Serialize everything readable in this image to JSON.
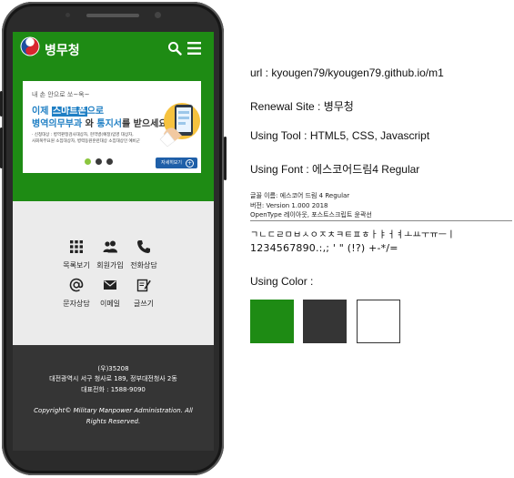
{
  "phone": {
    "header": {
      "logo_text": "병무청",
      "search_icon": "search-icon",
      "menu_icon": "hamburger-menu-icon"
    },
    "banner": {
      "small_text": "내 손 안으로 쏘~옥~",
      "line1_a": "이제 ",
      "line1_b": "스마트폰",
      "line1_c": "으로",
      "line2_a": "병역의무부과",
      "line2_b": " 와 ",
      "line2_c": "통지서",
      "line2_d": "를 받으세요!",
      "info_1": "· 신청대상 : 병역판정검사대상자, 현역병(예정)입영 대상자,",
      "info_2": "  사회복무요원 소집대상자, 병력동원훈련대상 소집대상인 예비군",
      "more_label": "자세히보기",
      "dots_active_index": 0,
      "dot_count": 3
    },
    "quick_menu": [
      {
        "label": "목록보기",
        "icon": "grid-icon"
      },
      {
        "label": "회원가입",
        "icon": "users-icon"
      },
      {
        "label": "전화상담",
        "icon": "phone-icon"
      },
      {
        "label": "문자상담",
        "icon": "at-sign-icon"
      },
      {
        "label": "이메일",
        "icon": "envelope-icon"
      },
      {
        "label": "글쓰기",
        "icon": "write-icon"
      }
    ],
    "footer": {
      "postcode": "(우)35208",
      "address": "대전광역시 서구 청사로 189, 정부대전청사 2동",
      "phone": "대표전화 : 1588-9090",
      "copyright_1": "Copyright© Military Manpower Administration. All",
      "copyright_2": "Rights Reserved."
    }
  },
  "info": {
    "url": "url : kyougen79/kyougen79.github.io/m1",
    "renewal_site": "Renewal Site : 병무청",
    "using_tool": "Using Tool : HTML5, CSS, Javascript",
    "using_font": "Using Font : 에스코어드림4 Regular",
    "font_meta": {
      "name": "글꼴 이름: 에스코어 드림 4 Regular",
      "version": "버전: Version 1.000 2018",
      "type": "OpenType 레이아웃, 포스트스크립트 윤곽선"
    },
    "font_sample": {
      "line1": "ㄱㄴㄷㄹㅁㅂㅅㅇㅈㅊㅋㅌㅍㅎㅏㅑㅓㅕㅗㅛㅜㅠㅡㅣ",
      "line2": "1234567890.:,; ' \" (!?) +-*/="
    },
    "using_color": "Using Color :",
    "colors": [
      "#1e8b14",
      "#353535",
      "#ffffff"
    ]
  }
}
